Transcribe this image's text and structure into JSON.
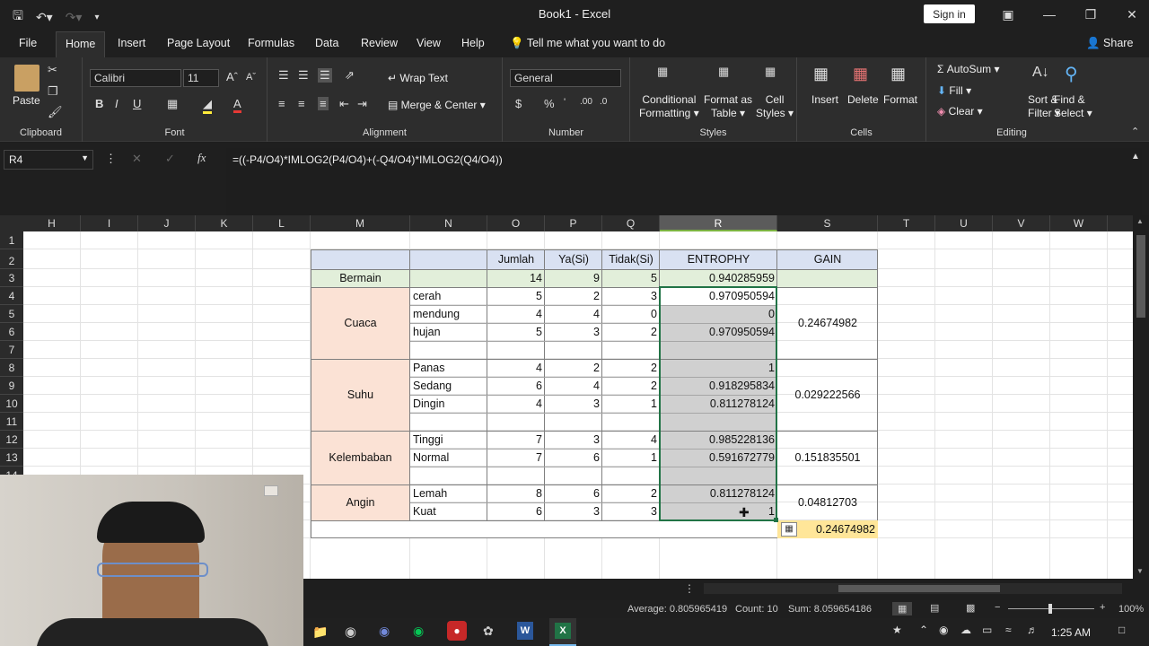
{
  "window": {
    "title": "Book1 - Excel",
    "signin": "Sign in"
  },
  "menu": {
    "tabs": [
      "File",
      "Home",
      "Insert",
      "Page Layout",
      "Formulas",
      "Data",
      "Review",
      "View",
      "Help"
    ],
    "tell": "Tell me what you want to do",
    "share": "Share"
  },
  "ribbon": {
    "clipboard": {
      "paste": "Paste",
      "label": "Clipboard"
    },
    "font": {
      "name": "Calibri",
      "size": "11",
      "label": "Font"
    },
    "alignment": {
      "wrap": "Wrap Text",
      "merge": "Merge & Center",
      "label": "Alignment"
    },
    "number": {
      "format": "General",
      "label": "Number"
    },
    "styles": {
      "cond": [
        "Conditional",
        "Formatting"
      ],
      "table": [
        "Format as",
        "Table"
      ],
      "cell": [
        "Cell",
        "Styles"
      ],
      "label": "Styles"
    },
    "cells": {
      "insert": "Insert",
      "delete": "Delete",
      "format": "Format",
      "label": "Cells"
    },
    "editing": {
      "autosum": "AutoSum",
      "fill": "Fill",
      "clear": "Clear",
      "sort": [
        "Sort &",
        "Filter"
      ],
      "find": [
        "Find &",
        "Select"
      ],
      "label": "Editing"
    }
  },
  "formula_bar": {
    "name_box": "R4",
    "formula": "=((-P4/O4)*IMLOG2(P4/O4)+(-Q4/O4)*IMLOG2(Q4/O4))"
  },
  "columns": [
    "H",
    "I",
    "J",
    "K",
    "L",
    "M",
    "N",
    "O",
    "P",
    "Q",
    "R",
    "S",
    "T",
    "U",
    "V",
    "W"
  ],
  "rows": [
    "1",
    "2",
    "3",
    "4",
    "5",
    "6",
    "7",
    "8",
    "9",
    "10",
    "11",
    "12",
    "13",
    "14",
    "15",
    "16",
    "17"
  ],
  "table": {
    "headers": {
      "jumlah": "Jumlah",
      "ya": "Ya(Si)",
      "tidak": "Tidak(Si)",
      "entropy": "ENTROPHY",
      "gain": "GAIN"
    },
    "total": {
      "label": "Bermain",
      "jumlah": "14",
      "ya": "9",
      "tidak": "5",
      "entropy": "0.940285959"
    },
    "groups": [
      {
        "name": "Cuaca",
        "gain": "0.24674982",
        "rows": [
          {
            "n": "cerah",
            "o": "5",
            "p": "2",
            "q": "3",
            "r": "0.970950594"
          },
          {
            "n": "mendung",
            "o": "4",
            "p": "4",
            "q": "0",
            "r": "0"
          },
          {
            "n": "hujan",
            "o": "5",
            "p": "3",
            "q": "2",
            "r": "0.970950594"
          }
        ]
      },
      {
        "name": "Suhu",
        "gain": "0.029222566",
        "rows": [
          {
            "n": "Panas",
            "o": "4",
            "p": "2",
            "q": "2",
            "r": "1"
          },
          {
            "n": "Sedang",
            "o": "6",
            "p": "4",
            "q": "2",
            "r": "0.918295834"
          },
          {
            "n": "Dingin",
            "o": "4",
            "p": "3",
            "q": "1",
            "r": "0.811278124"
          }
        ]
      },
      {
        "name": "Kelembaban",
        "gain": "0.151835501",
        "rows": [
          {
            "n": "Tinggi",
            "o": "7",
            "p": "3",
            "q": "4",
            "r": "0.985228136"
          },
          {
            "n": "Normal",
            "o": "7",
            "p": "6",
            "q": "1",
            "r": "0.591672779"
          }
        ]
      },
      {
        "name": "Angin",
        "gain": "0.04812703",
        "rows": [
          {
            "n": "Lemah",
            "o": "8",
            "p": "6",
            "q": "2",
            "r": "0.811278124"
          },
          {
            "n": "Kuat",
            "o": "6",
            "p": "3",
            "q": "3",
            "r": "1"
          }
        ]
      }
    ],
    "max_gain": "0.24674982"
  },
  "status": {
    "average": "Average: 0.805965419",
    "count": "Count: 10",
    "sum": "Sum: 8.059654186",
    "zoom": "100%"
  },
  "taskbar": {
    "time": "1:25 AM"
  },
  "colors": {
    "header_blue": "#d9e1f2",
    "total_green": "#e2efda",
    "label_pink": "#fbe2d5",
    "selection_grey": "#d0d0d0",
    "gain_yellow": "#ffe699",
    "accent_green": "#217346"
  }
}
